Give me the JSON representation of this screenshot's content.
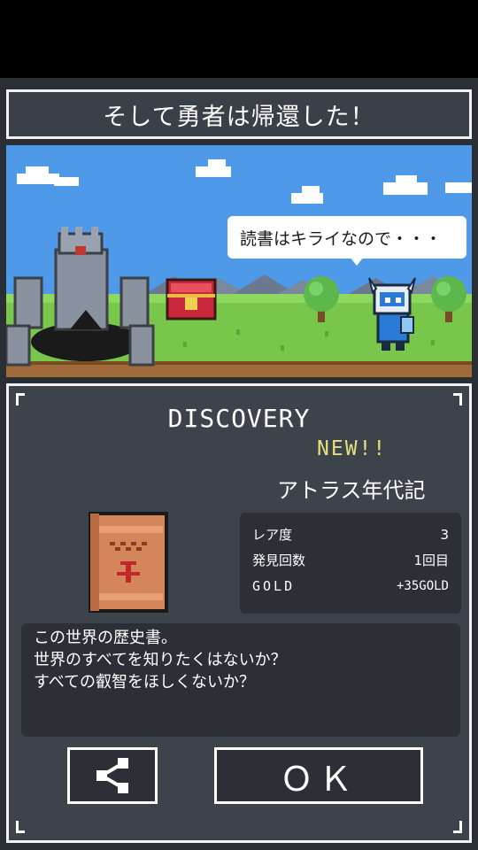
{
  "title": "そして勇者は帰還した！",
  "scene": {
    "speech": "読書はキライなので・・・"
  },
  "result": {
    "heading": "DISCOVERY",
    "new_badge": "NEW!!",
    "item_name": "アトラス年代記",
    "stats": [
      {
        "label": "レア度",
        "value": "3"
      },
      {
        "label": "発見回数",
        "value": "1回目"
      },
      {
        "label": "GOLD",
        "value": "+35GOLD"
      }
    ],
    "description": [
      "この世界の歴史書。",
      "世界のすべてを知りたくはないか？",
      "すべての叡智をほしくないか？"
    ]
  },
  "buttons": {
    "share_icon": "share-icon",
    "ok_label": "ＯＫ"
  },
  "colors": {
    "panel": "#3d434a",
    "inner_box": "#2c3036",
    "new_badge": "#e6e07a",
    "sky": "#4f9ae8"
  }
}
